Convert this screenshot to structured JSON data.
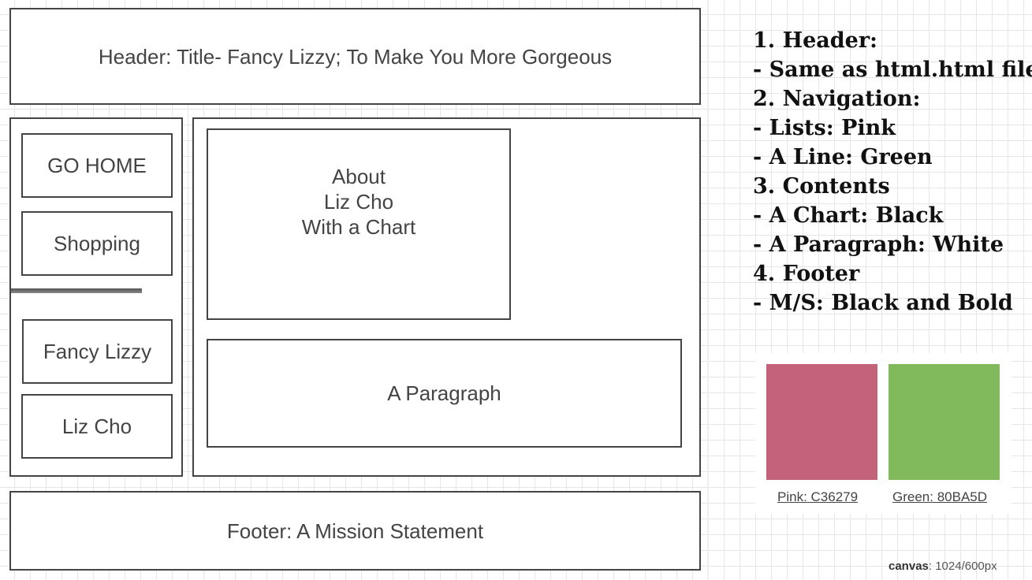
{
  "wireframe": {
    "header_label": "Header: Title- Fancy Lizzy; To Make You More Gorgeous",
    "nav_items": [
      "GO HOME",
      "Shopping",
      "Fancy Lizzy",
      "Liz Cho"
    ],
    "chart_box_lines": [
      "About",
      "Liz Cho",
      "With a Chart"
    ],
    "paragraph_label": "A Paragraph",
    "footer_label": "Footer: A Mission Statement"
  },
  "notes": [
    "1. Header:",
    "- Same as html.html file",
    "2. Navigation:",
    "- Lists: Pink",
    "- A Line: Green",
    "3. Contents",
    "- A Chart: Black",
    "- A Paragraph: White",
    "4. Footer",
    "- M/S: Black and Bold"
  ],
  "swatches": [
    {
      "label": "Pink: C36279",
      "color": "#C36279"
    },
    {
      "label": "Green: 80BA5D",
      "color": "#80BA5D"
    }
  ],
  "canvas_note": {
    "key": "canvas",
    "value": ": 1024/600px"
  },
  "colors": {
    "border": "#444444",
    "nav_line": "#6b6b6b"
  }
}
